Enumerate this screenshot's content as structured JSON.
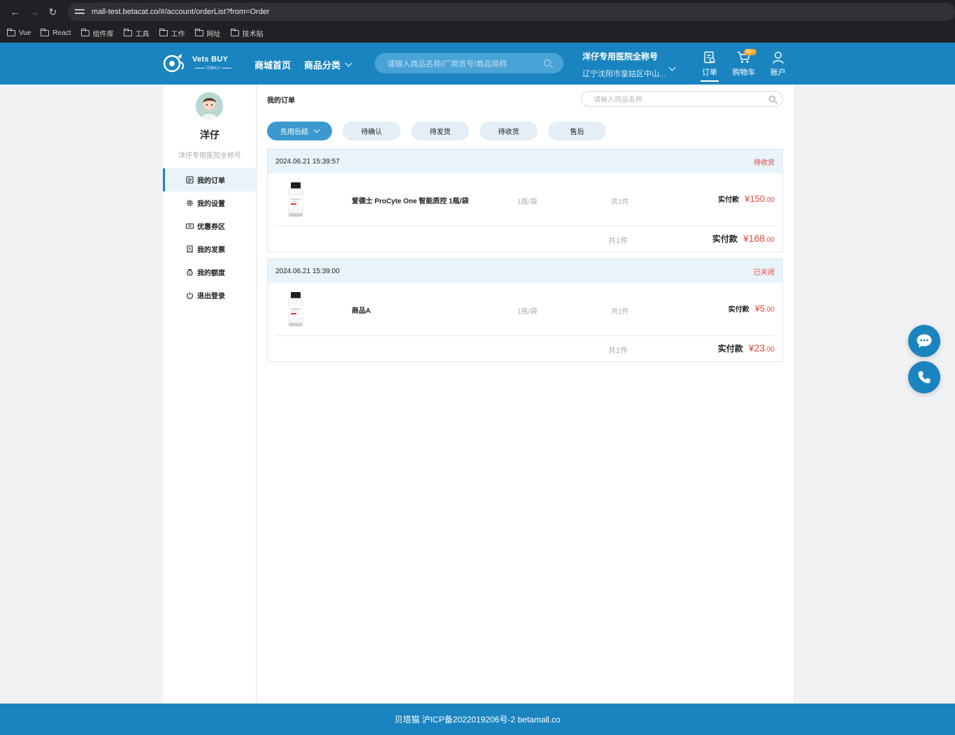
{
  "browser": {
    "url": "mall-test.betacat.co/#/account/orderList?from=Order",
    "bookmarks": [
      "Vue",
      "React",
      "组件库",
      "工具",
      "工作",
      "网址",
      "技术贴"
    ]
  },
  "header": {
    "logo_title": "Vets BUY",
    "logo_sub": "贝塔BUY",
    "nav_home": "商城首页",
    "nav_category": "商品分类",
    "search_placeholder": "请输入商品名称/厂商货号/商品简称",
    "hospital_name": "洋仔专用医院全称号",
    "hospital_address": "辽宁沈阳市皇姑区中山...",
    "icon_order_label": "订单",
    "icon_cart_label": "购物车",
    "cart_badge": "99+",
    "icon_account_label": "账户",
    "brand_color": "#1a84c0"
  },
  "sidebar": {
    "user_name": "洋仔",
    "user_hospital": "洋仔专用医院全称号",
    "items": [
      {
        "label": "我的订单",
        "icon": "list-icon",
        "active": true
      },
      {
        "label": "我的设置",
        "icon": "gear-icon"
      },
      {
        "label": "优惠券区",
        "icon": "coupon-icon"
      },
      {
        "label": "我的发票",
        "icon": "invoice-icon"
      },
      {
        "label": "我的额度",
        "icon": "credit-icon"
      },
      {
        "label": "退出登录",
        "icon": "power-icon"
      }
    ]
  },
  "main": {
    "title": "我的订单",
    "search_placeholder": "请输入商品名称",
    "tabs": [
      {
        "label": "先用后结",
        "active": true
      },
      {
        "label": "待确认"
      },
      {
        "label": "待发货"
      },
      {
        "label": "待收货"
      },
      {
        "label": "售后"
      }
    ],
    "orders": [
      {
        "time": "2024.06.21 15:39:57",
        "status": "待收货",
        "product_name": "爱德士 ProCyte One 智能质控 1瓶/袋",
        "unit": "1瓶/袋",
        "qty": "共1件",
        "pay_label": "实付款",
        "pay_int": "¥150",
        "pay_dec": ".00",
        "sum_qty": "共1件",
        "sum_label": "实付款",
        "sum_int": "¥168",
        "sum_dec": ".00"
      },
      {
        "time": "2024.06.21 15:39:00",
        "status": "已关闭",
        "product_name": "商品A",
        "unit": "1瓶/袋",
        "qty": "共1件",
        "pay_label": "实付款",
        "pay_int": "¥5",
        "pay_dec": ".00",
        "sum_qty": "共1件",
        "sum_label": "实付款",
        "sum_int": "¥23",
        "sum_dec": ".00"
      }
    ]
  },
  "footer": {
    "text": "贝塔猫 沪ICP备2022019206号-2 betamall.co"
  },
  "colors": {
    "accent": "#1a84c0",
    "price_red": "#e8463a"
  }
}
